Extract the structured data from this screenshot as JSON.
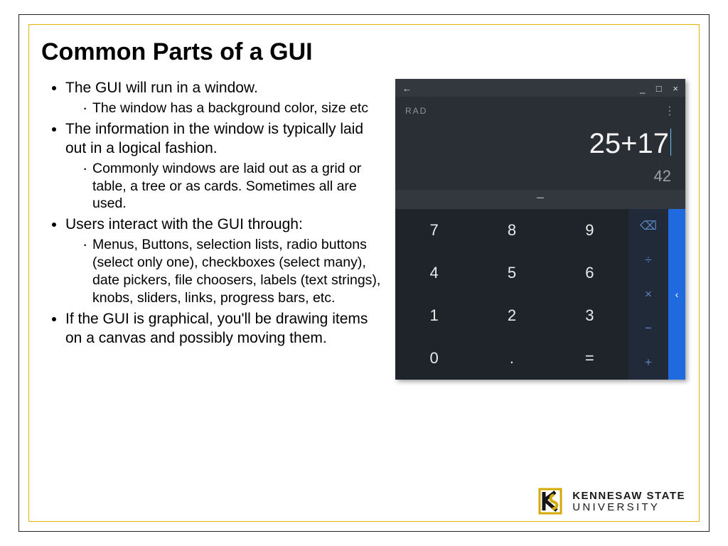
{
  "title": "Common Parts of a GUI",
  "bullets": {
    "b1": "The GUI will run in a window.",
    "b1a": "The window has a background color, size etc",
    "b2": "The information in the window is typically laid out in a logical fashion.",
    "b2a": "Commonly windows are laid out as a grid or table, a tree or as cards. Sometimes all are used.",
    "b3": "Users interact with the GUI through:",
    "b3a": "Menus, Buttons, selection lists, radio buttons (select only one), checkboxes (select many), date pickers, file choosers, labels (text strings), knobs, sliders, links, progress bars, etc.",
    "b4": "If the GUI is graphical, you'll be drawing items on a canvas and possibly moving them."
  },
  "calculator": {
    "back": "←",
    "win_min": "_",
    "win_max": "□",
    "win_close": "×",
    "mode": "RAD",
    "kebab": "⋮",
    "expression": "25+17",
    "result": "42",
    "collapse": "–",
    "keys": {
      "k7": "7",
      "k8": "8",
      "k9": "9",
      "k4": "4",
      "k5": "5",
      "k6": "6",
      "k1": "1",
      "k2": "2",
      "k3": "3",
      "k0": "0",
      "kdot": ".",
      "keq": "="
    },
    "ops": {
      "del": "⌫",
      "div": "÷",
      "mul": "×",
      "sub": "−",
      "add": "+"
    },
    "expand": "‹"
  },
  "logo": {
    "line1": "KENNESAW STATE",
    "line2": "UNIVERSITY"
  }
}
